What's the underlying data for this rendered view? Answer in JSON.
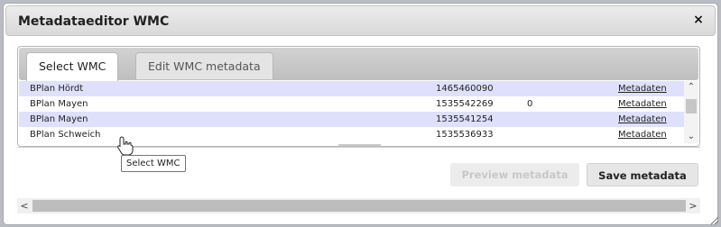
{
  "dialog": {
    "title": "Metadataeditor WMC",
    "close_label": "×"
  },
  "tabs": [
    {
      "label": "Select WMC",
      "active": true
    },
    {
      "label": "Edit WMC metadata",
      "active": false
    }
  ],
  "rows": [
    {
      "name": "BPlan Hördt",
      "id": "1465460090",
      "extra": "",
      "link": "Metadaten"
    },
    {
      "name": "BPlan Mayen",
      "id": "1535542269",
      "extra": "0",
      "link": "Metadaten"
    },
    {
      "name": "BPlan Mayen",
      "id": "1535541254",
      "extra": "",
      "link": "Metadaten"
    },
    {
      "name": "BPlan Schweich",
      "id": "1535536933",
      "extra": "",
      "link": "Metadaten"
    }
  ],
  "tooltip": "Select WMC",
  "buttons": {
    "preview": "Preview metadata",
    "save": "Save metadata"
  },
  "scroll": {
    "up": "⌃",
    "down": "⌄",
    "left": "<",
    "right": ">"
  }
}
